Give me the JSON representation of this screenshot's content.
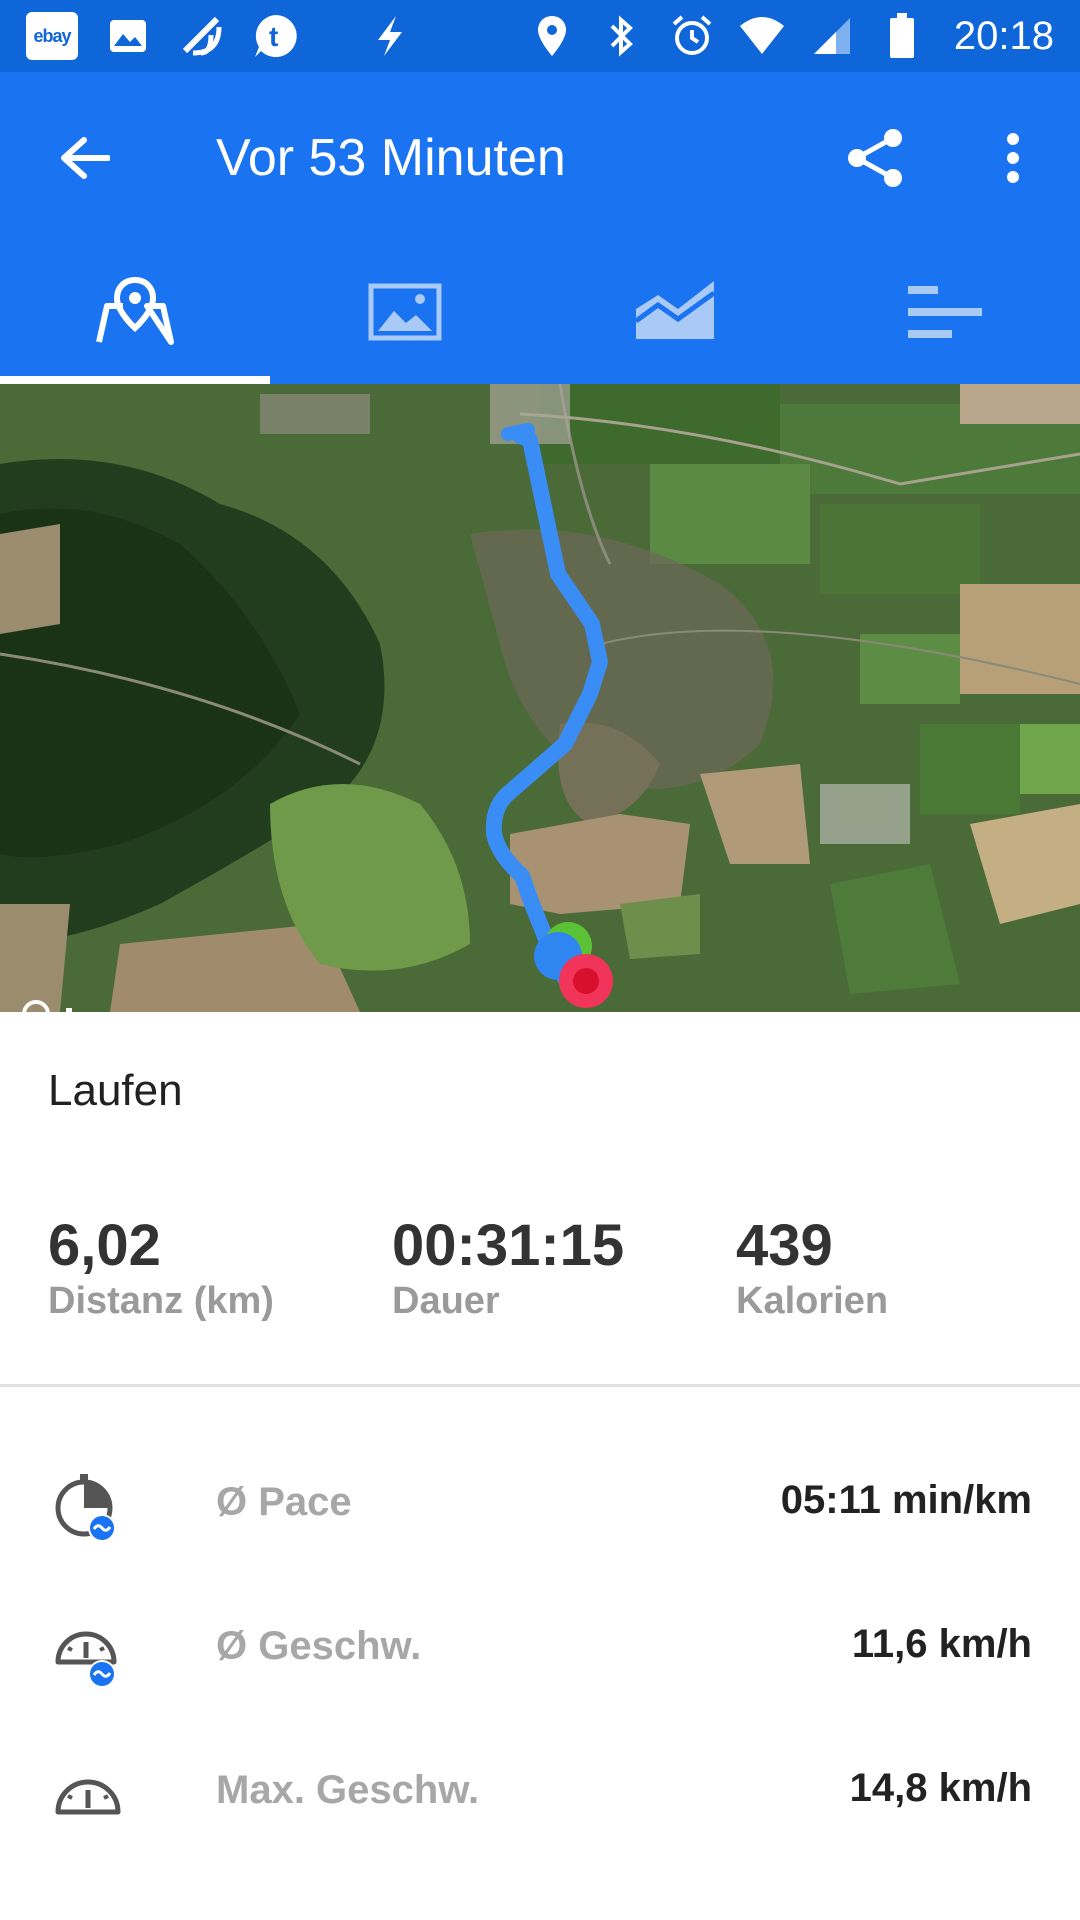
{
  "statusbar": {
    "time": "20:18",
    "left_icons": [
      "ebay-icon",
      "image-icon",
      "nfc-icon",
      "tumblr-icon",
      "flash-icon"
    ],
    "right_icons": [
      "location-icon",
      "bluetooth-icon",
      "alarm-icon",
      "wifi-icon",
      "signal-icon",
      "battery-icon"
    ],
    "ebay_label": "ebay"
  },
  "appbar": {
    "title": "Vor 53 Minuten"
  },
  "tabs": [
    {
      "name": "map",
      "icon": "map-pin-icon",
      "selected": true
    },
    {
      "name": "photos",
      "icon": "image-icon",
      "selected": false
    },
    {
      "name": "charts",
      "icon": "area-chart-icon",
      "selected": false
    },
    {
      "name": "splits",
      "icon": "bars-icon",
      "selected": false
    }
  ],
  "activity": {
    "type": "Laufen"
  },
  "stats": [
    {
      "value": "6,02",
      "label": "Distanz (km)"
    },
    {
      "value": "00:31:15",
      "label": "Dauer"
    },
    {
      "value": "439",
      "label": "Kalorien"
    }
  ],
  "details": [
    {
      "icon": "pace-icon",
      "label": "Ø Pace",
      "value": "05:11 min/km"
    },
    {
      "icon": "speed-avg-icon",
      "label": "Ø Geschw.",
      "value": "11,6 km/h"
    },
    {
      "icon": "speed-max-icon",
      "label": "Max. Geschw.",
      "value": "14,8 km/h"
    }
  ],
  "colors": {
    "statusbar": "#0F66D9",
    "appbar": "#1A73F0",
    "route": "#3A8DF5",
    "start_marker": "#5BC236",
    "end_marker": "#E8263F"
  }
}
